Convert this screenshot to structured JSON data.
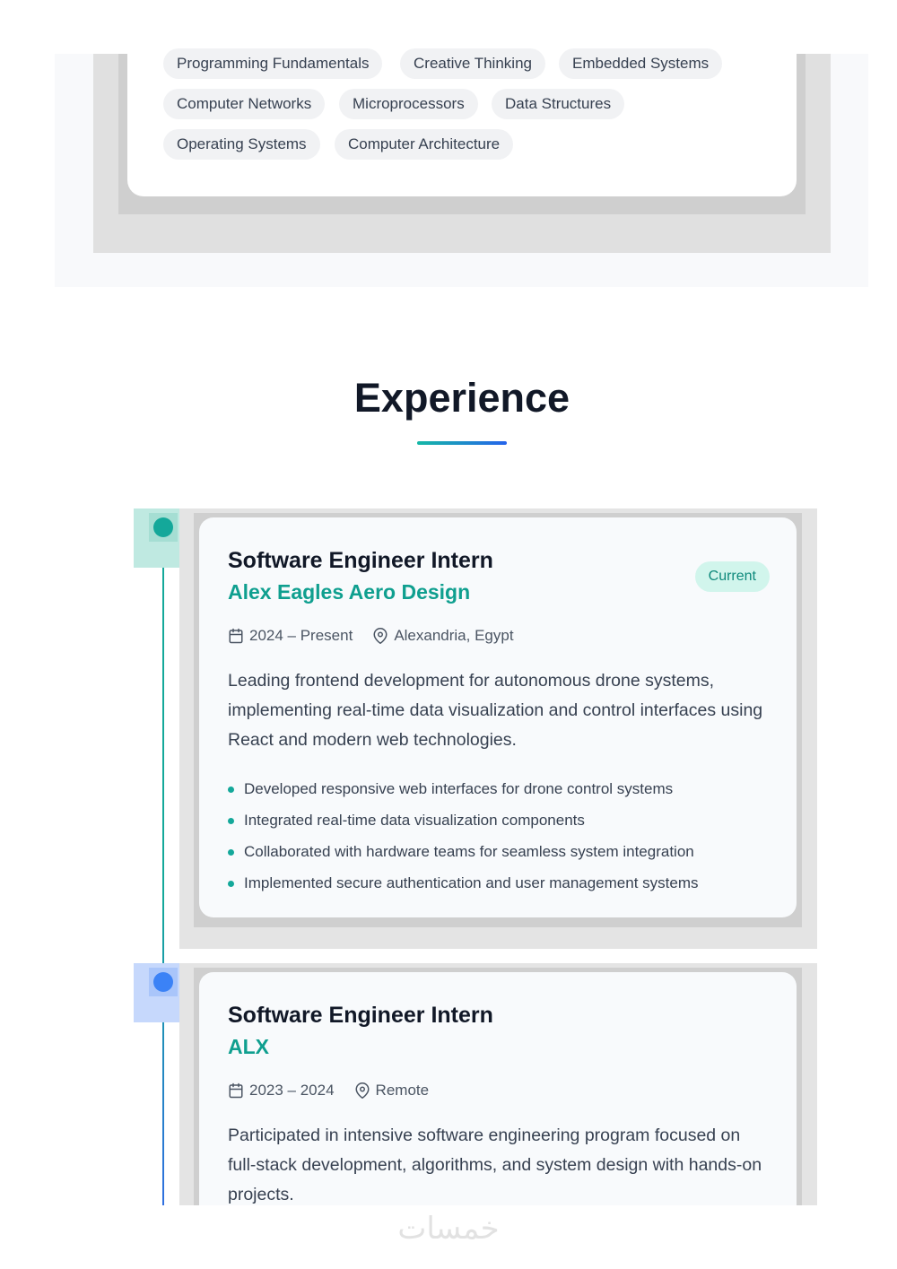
{
  "skills": {
    "tags": [
      "Programming Fundamentals",
      "Creative Thinking",
      "Embedded Systems",
      "Computer Networks",
      "Microprocessors",
      "Data Structures",
      "Operating Systems",
      "Computer Architecture"
    ]
  },
  "experience": {
    "title": "Experience",
    "jobs": [
      {
        "title": "Software Engineer Intern",
        "company": "Alex Eagles Aero Design",
        "badge": "Current",
        "dates": "2024 – Present",
        "location": "Alexandria, Egypt",
        "description": "Leading frontend development for autonomous drone systems, implementing real-time data visualization and control interfaces using React and modern web technologies.",
        "highlights": [
          "Developed responsive web interfaces for drone control systems",
          "Integrated real-time data visualization components",
          "Collaborated with hardware teams for seamless system integration",
          "Implemented secure authentication and user management systems"
        ],
        "accent": "#14a89a"
      },
      {
        "title": "Software Engineer Intern",
        "company": "ALX",
        "dates": "2023 – 2024",
        "location": "Remote",
        "description": "Participated in intensive software engineering program focused on full-stack development, algorithms, and system design with hands-on projects.",
        "accent": "#3b82f6"
      }
    ]
  },
  "watermark": "خمسات",
  "icons": [
    "calendar-icon",
    "location-pin-icon"
  ]
}
